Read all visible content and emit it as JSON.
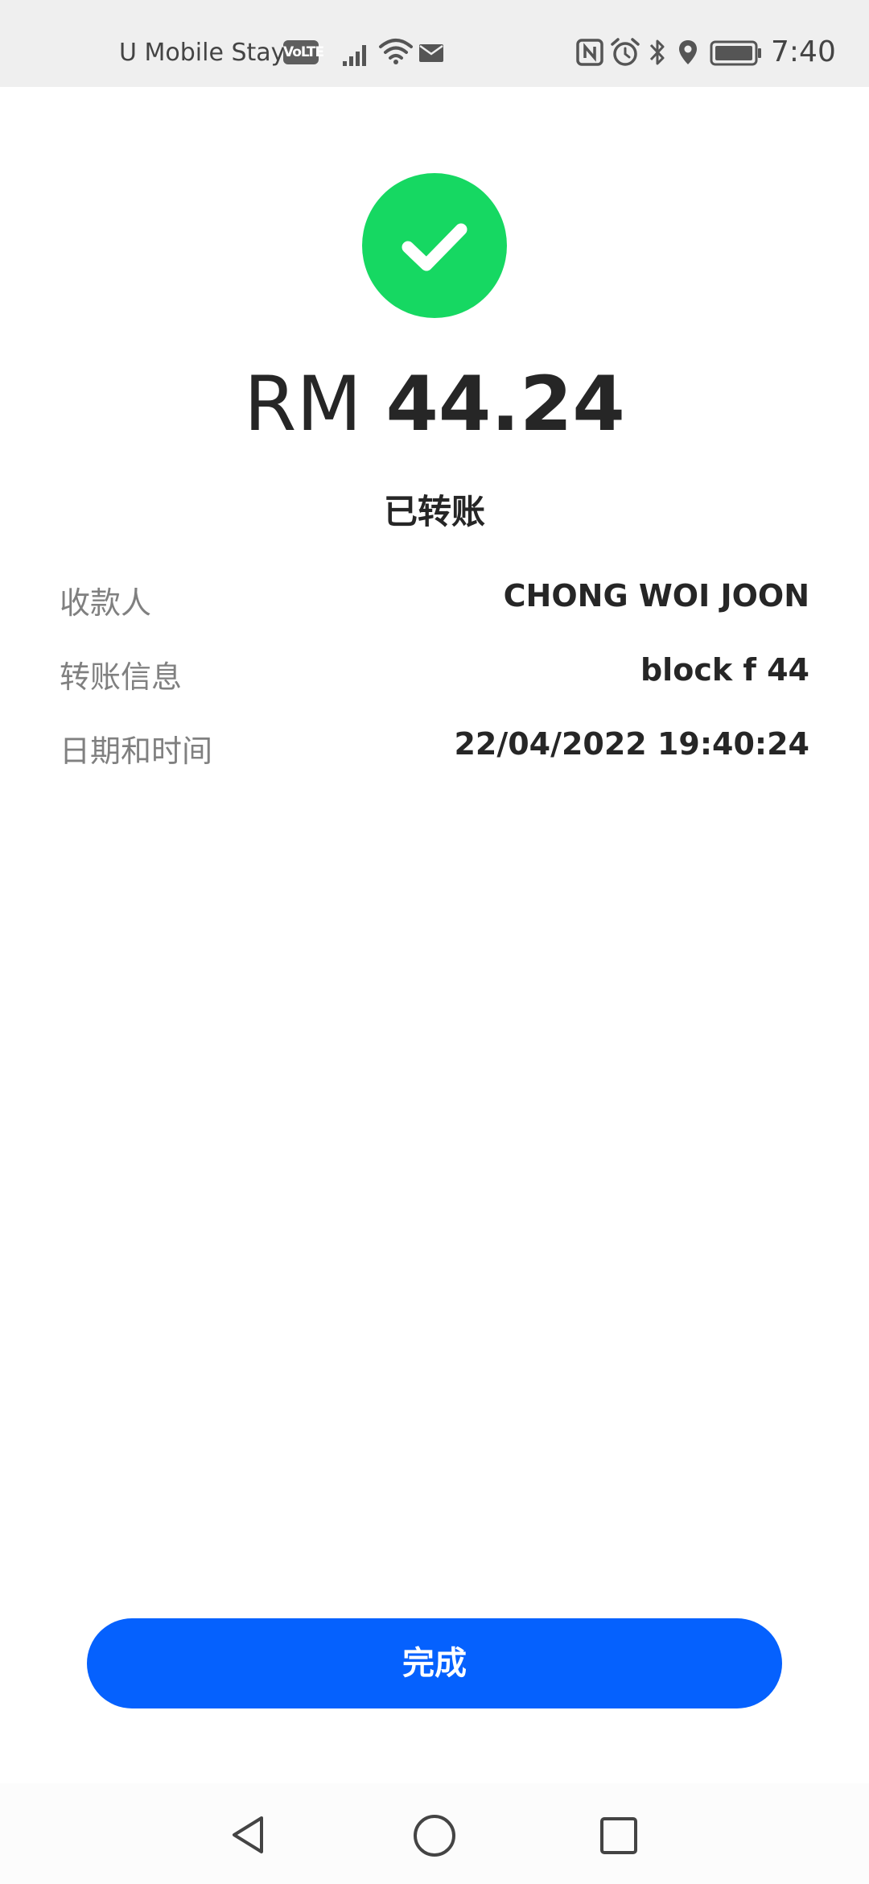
{
  "status_bar": {
    "carrier": "U Mobile Stay...",
    "volte": "VoLTE",
    "time": "7:40",
    "icons": [
      "signal-icon",
      "wifi-icon",
      "mail-icon",
      "nfc-icon",
      "alarm-icon",
      "bluetooth-icon",
      "location-icon",
      "battery-icon"
    ]
  },
  "receipt": {
    "success_icon": "check-icon",
    "success_color": "#16d862",
    "currency": "RM",
    "amount": "44.24",
    "status": "已转账",
    "details": [
      {
        "label": "收款人",
        "value": "CHONG WOI JOON"
      },
      {
        "label": "转账信息",
        "value": "block f 44"
      },
      {
        "label": "日期和时间",
        "value": "22/04/2022 19:40:24"
      }
    ]
  },
  "actions": {
    "done_label": "完成",
    "button_color": "#0561fe"
  },
  "nav_bar": {
    "icons": [
      "back-icon",
      "home-icon",
      "recents-icon"
    ]
  }
}
